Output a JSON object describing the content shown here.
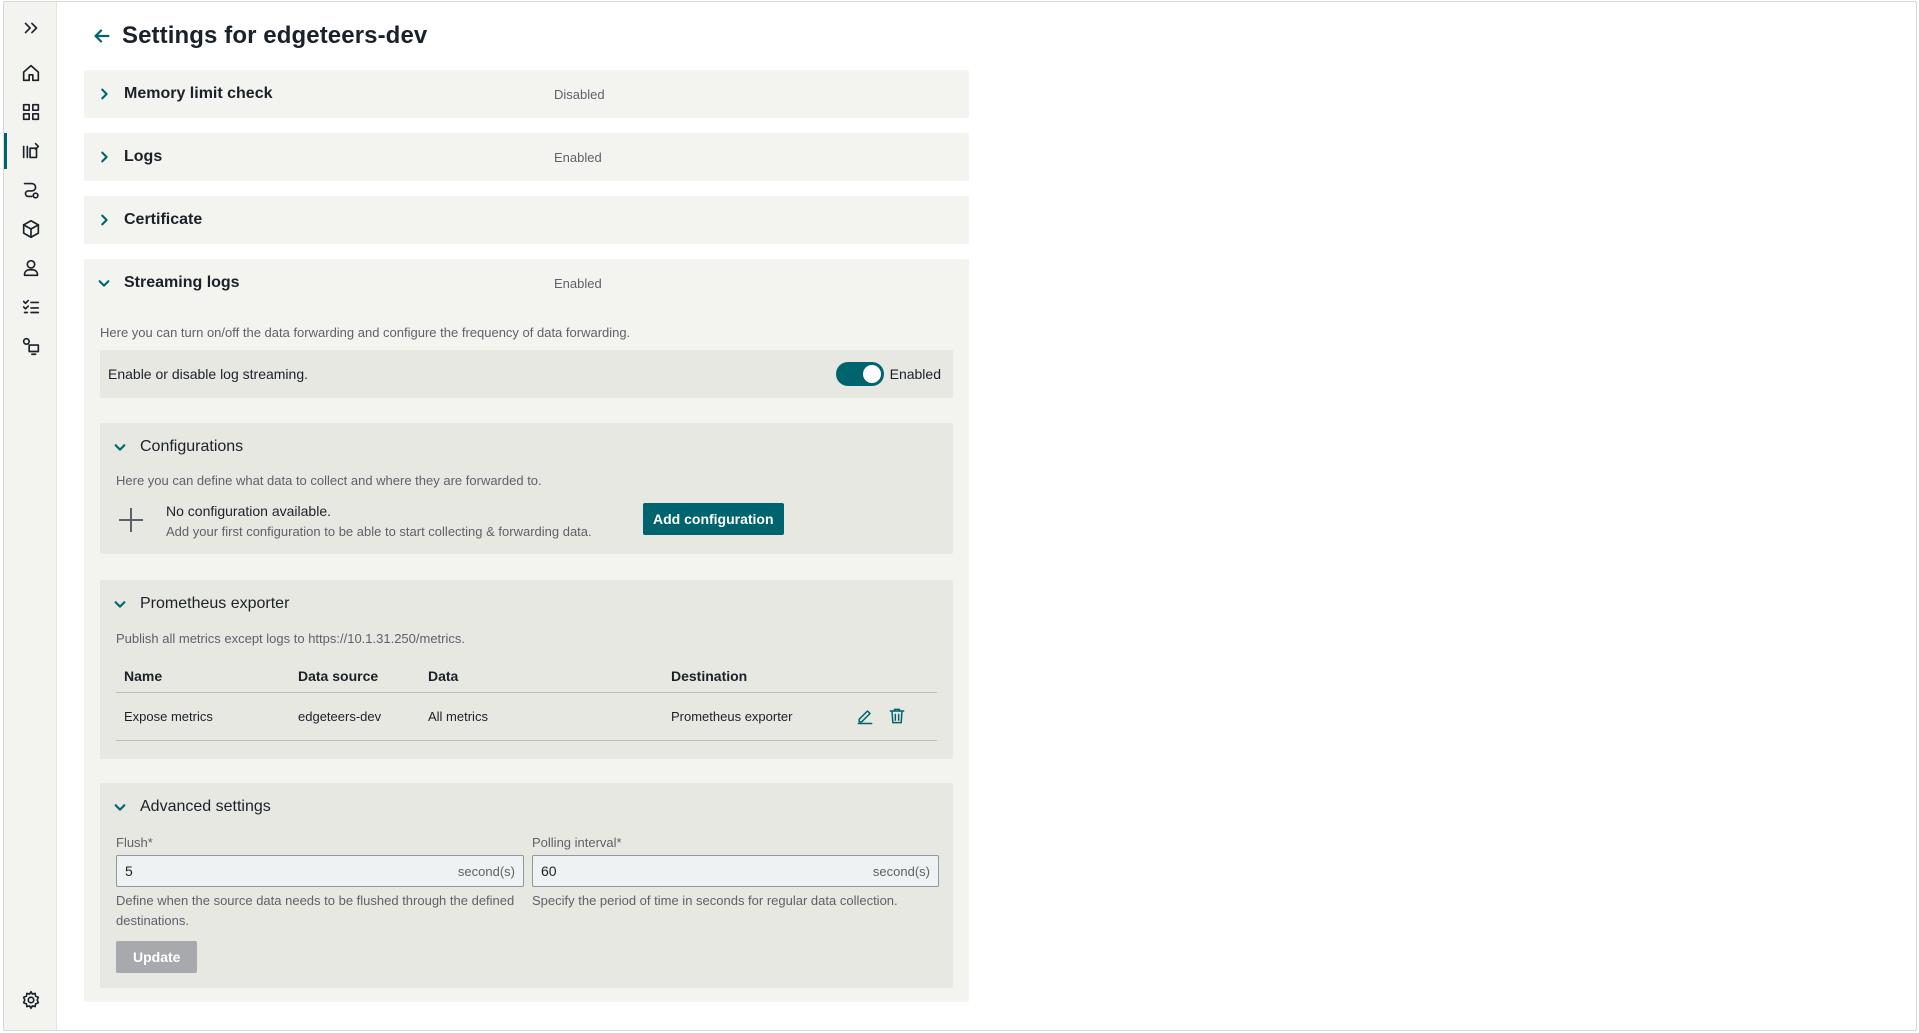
{
  "sidebar": {
    "items": [
      {
        "icon": "expand-icon"
      },
      {
        "icon": "home-icon"
      },
      {
        "icon": "dashboard-grid-icon"
      },
      {
        "icon": "library-icon"
      },
      {
        "icon": "workflow-icon"
      },
      {
        "icon": "cube-icon"
      },
      {
        "icon": "user-icon"
      },
      {
        "icon": "checklist-icon"
      },
      {
        "icon": "device-config-icon"
      },
      {
        "icon": "gear-icon"
      }
    ],
    "active_index": 3
  },
  "header": {
    "title": "Settings for edgeteers-dev"
  },
  "sections": {
    "memory": {
      "title": "Memory limit check",
      "status": "Disabled"
    },
    "logs": {
      "title": "Logs",
      "status": "Enabled"
    },
    "certificate": {
      "title": "Certificate"
    },
    "streaming": {
      "title": "Streaming logs",
      "status": "Enabled",
      "description": "Here you can turn on/off the data forwarding and configure the frequency of data forwarding.",
      "toggle_label": "Enable or disable log streaming.",
      "toggle_state": "Enabled"
    }
  },
  "configurations": {
    "title": "Configurations",
    "description": "Here you can define what data to collect and where they are forwarded to.",
    "empty_title": "No configuration available.",
    "empty_text": "Add your first configuration to be able to start collecting & forwarding data.",
    "add_button": "Add configuration"
  },
  "prometheus": {
    "title": "Prometheus exporter",
    "description": "Publish all metrics except logs to https://10.1.31.250/metrics.",
    "columns": [
      "Name",
      "Data source",
      "Data",
      "Destination"
    ],
    "rows": [
      {
        "name": "Expose metrics",
        "source": "edgeteers-dev",
        "data": "All metrics",
        "destination": "Prometheus exporter"
      }
    ]
  },
  "advanced": {
    "title": "Advanced settings",
    "flush": {
      "label": "Flush*",
      "value": "5",
      "unit": "second(s)",
      "help": "Define when the source data needs to be flushed through the defined destinations."
    },
    "polling": {
      "label": "Polling interval*",
      "value": "60",
      "unit": "second(s)",
      "help": "Specify the period of time in seconds for regular data collection."
    },
    "update_button": "Update"
  },
  "colors": {
    "accent": "#00646e",
    "panel": "#f3f3f0",
    "subpanel": "#e8e8e3"
  }
}
